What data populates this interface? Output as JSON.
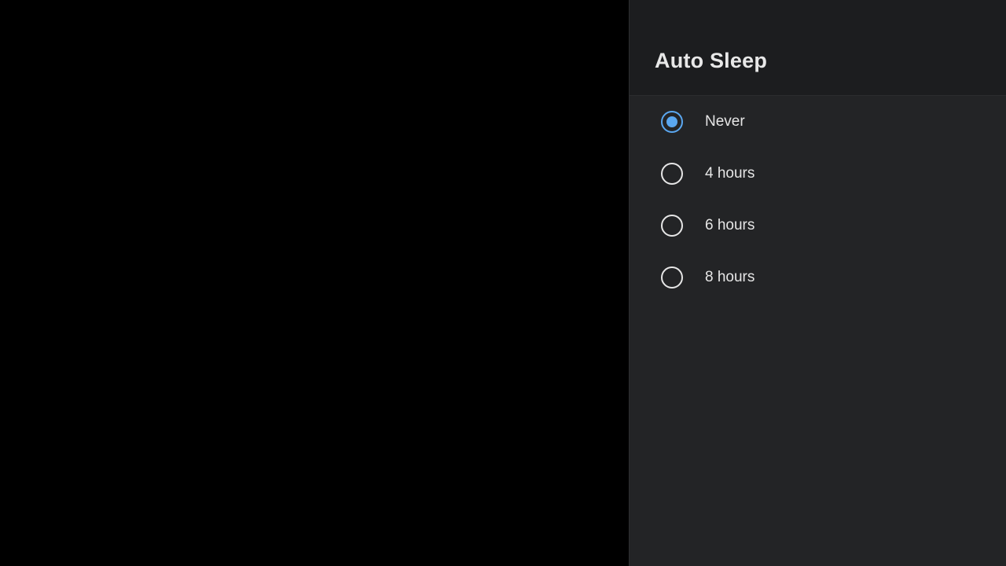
{
  "panel": {
    "title": "Auto Sleep",
    "accent_color": "#5aa7f0",
    "options": [
      {
        "label": "Never",
        "selected": true
      },
      {
        "label": "4 hours",
        "selected": false
      },
      {
        "label": "6 hours",
        "selected": false
      },
      {
        "label": "8 hours",
        "selected": false
      }
    ]
  }
}
